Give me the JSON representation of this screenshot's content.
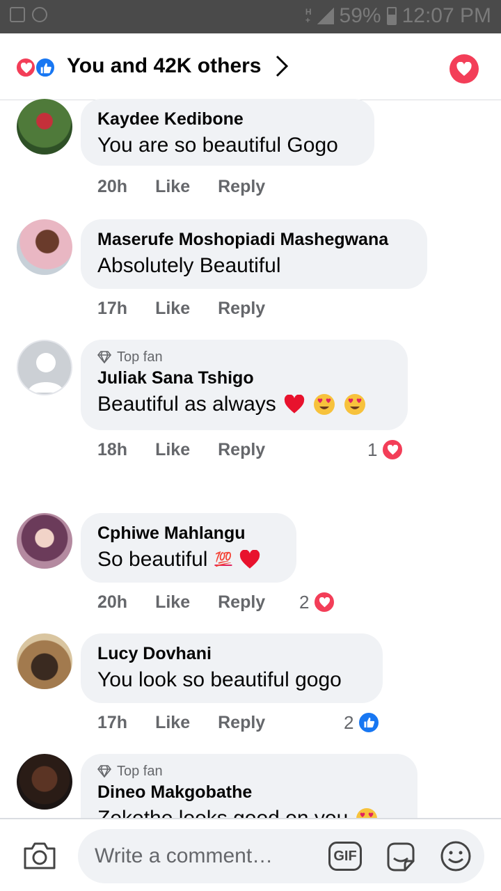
{
  "status_bar": {
    "battery": "59%",
    "time": "12:07 PM"
  },
  "header": {
    "reactions_summary": "You and 42K others"
  },
  "comments": [
    {
      "author": "Kaydee Kedibone",
      "text": "You are so beautiful Gogo",
      "time": "20h",
      "like": "Like",
      "reply": "Reply",
      "top_fan": "",
      "reaction_count": ""
    },
    {
      "author": "Maserufe Moshopiadi Mashegwana",
      "text": "Absolutely Beautiful",
      "time": "17h",
      "like": "Like",
      "reply": "Reply",
      "top_fan": "",
      "reaction_count": ""
    },
    {
      "author": "Juliak Sana Tshigo",
      "text": "Beautiful as always",
      "time": "18h",
      "like": "Like",
      "reply": "Reply",
      "top_fan": "Top fan",
      "reaction_count": "1",
      "emojis": [
        "red-heart",
        "heart-eyes",
        "heart-eyes"
      ]
    },
    {
      "author": "Cphiwe Mahlangu",
      "text": "So beautiful",
      "time": "20h",
      "like": "Like",
      "reply": "Reply",
      "top_fan": "",
      "reaction_count": "2",
      "emojis": [
        "hundred-points",
        "red-heart"
      ]
    },
    {
      "author": "Lucy Dovhani",
      "text": "You look so beautiful gogo",
      "time": "17h",
      "like": "Like",
      "reply": "Reply",
      "top_fan": "",
      "reaction_count": "2"
    },
    {
      "author": "Dineo Makgobathe",
      "text": "Zekethe looks good on you",
      "time": "",
      "like": "",
      "reply": "",
      "top_fan": "Top fan",
      "reaction_count": "",
      "emojis": [
        "heart-eyes"
      ]
    }
  ],
  "composer": {
    "placeholder": "Write a comment…",
    "gif_label": "GIF"
  },
  "colors": {
    "love": "#f33e58",
    "like": "#1877f2",
    "bubble": "#f0f2f5",
    "meta": "#65676b"
  }
}
